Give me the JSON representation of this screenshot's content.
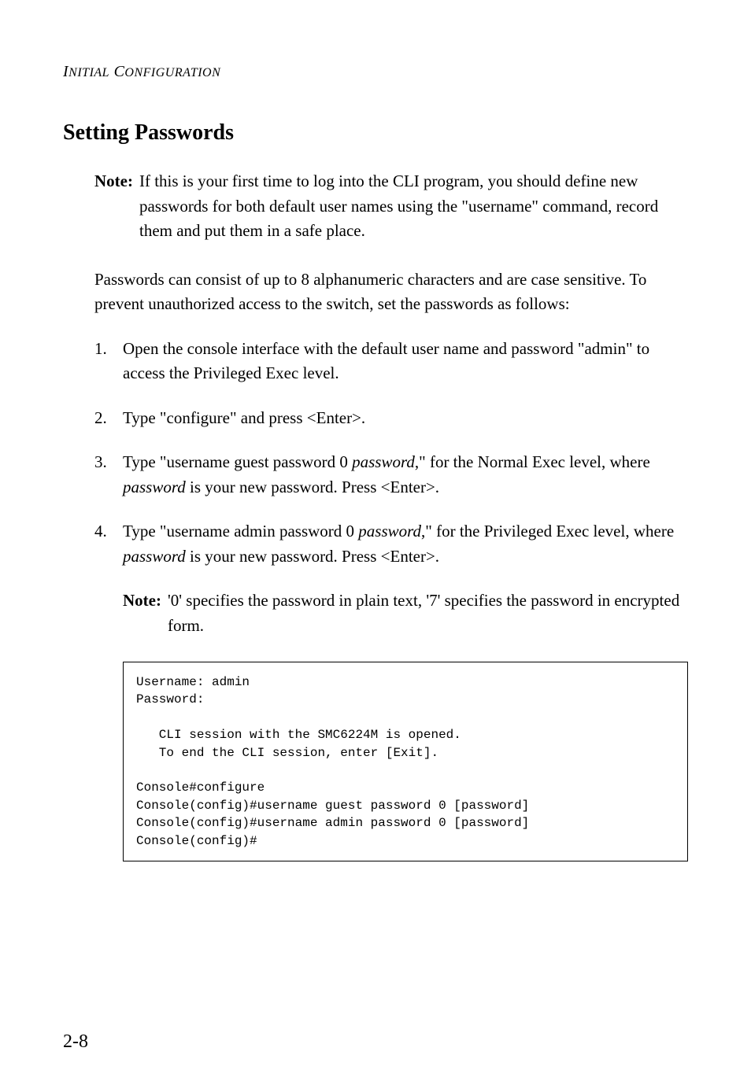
{
  "header": {
    "chapter_title_part1": "I",
    "chapter_title_part2": "NITIAL",
    "chapter_title_part3": " C",
    "chapter_title_part4": "ONFIGURATION"
  },
  "heading": "Setting Passwords",
  "note1": {
    "label": "Note:",
    "text": "If this is your first time to log into the CLI program, you should define new passwords for both default user names using the \"username\" command, record them and put them in a safe place."
  },
  "intro": "Passwords can consist of up to 8 alphanumeric characters and are case sensitive. To prevent unauthorized access to the switch, set the passwords as follows:",
  "steps": [
    {
      "num": "1.",
      "text": "Open the console interface with the default user name and password \"admin\" to access the Privileged Exec level."
    },
    {
      "num": "2.",
      "text": "Type \"configure\" and press <Enter>."
    },
    {
      "num": "3.",
      "prefix": "Type \"username guest password 0 ",
      "italic1": "password",
      "mid": ",\" for the Normal Exec level, where ",
      "italic2": "password",
      "suffix": " is your new password. Press <Enter>."
    },
    {
      "num": "4.",
      "prefix": "Type \"username admin password 0 ",
      "italic1": "password",
      "mid": ",\" for the Privileged Exec level, where ",
      "italic2": "password",
      "suffix": " is your new password. Press <Enter>."
    }
  ],
  "note2": {
    "label": "Note:",
    "text": "'0' specifies the password in plain text, '7' specifies the password in encrypted form."
  },
  "code": {
    "line1": "Username: admin",
    "line2": "Password:",
    "line3": "",
    "line4": "   CLI session with the SMC6224M is opened.",
    "line5": "   To end the CLI session, enter [Exit].",
    "line6": "",
    "line7": "Console#configure",
    "line8": "Console(config)#username guest password 0 [password]",
    "line9": "Console(config)#username admin password 0 [password]",
    "line10": "Console(config)#"
  },
  "page_number": "2-8"
}
